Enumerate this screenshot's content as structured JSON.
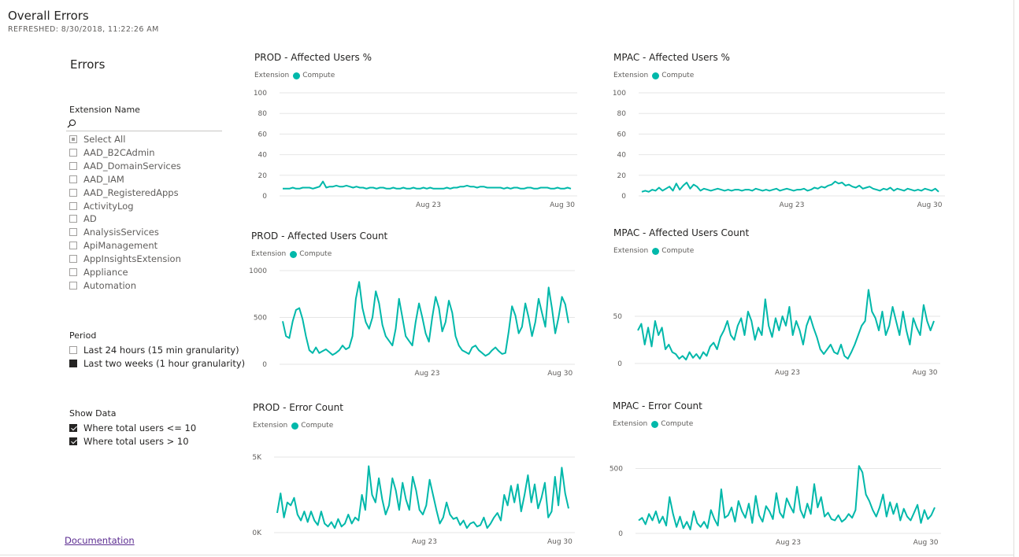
{
  "page": {
    "title": "Overall Errors",
    "refreshed": "REFRESHED: 8/30/2018, 11:22:26 AM"
  },
  "slicer": {
    "title": "Errors",
    "extension_label": "Extension Name",
    "search_icon": "search-icon",
    "extension_items": [
      {
        "label": "Select All",
        "state": "partial"
      },
      {
        "label": "AAD_B2CAdmin",
        "state": "unchecked"
      },
      {
        "label": "AAD_DomainServices",
        "state": "unchecked"
      },
      {
        "label": "AAD_IAM",
        "state": "unchecked"
      },
      {
        "label": "AAD_RegisteredApps",
        "state": "unchecked"
      },
      {
        "label": "ActivityLog",
        "state": "unchecked"
      },
      {
        "label": "AD",
        "state": "unchecked"
      },
      {
        "label": "AnalysisServices",
        "state": "unchecked"
      },
      {
        "label": "ApiManagement",
        "state": "unchecked"
      },
      {
        "label": "AppInsightsExtension",
        "state": "unchecked"
      },
      {
        "label": "Appliance",
        "state": "unchecked"
      },
      {
        "label": "Automation",
        "state": "unchecked"
      }
    ],
    "period_label": "Period",
    "period_items": [
      {
        "label": "Last 24 hours (15 min granularity)",
        "state": "unchecked"
      },
      {
        "label": "Last two weeks (1 hour granularity)",
        "state": "selected"
      }
    ],
    "show_data_label": "Show Data",
    "show_data_items": [
      {
        "label": "Where total users <= 10",
        "state": "checked"
      },
      {
        "label": "Where total users > 10",
        "state": "checked"
      }
    ]
  },
  "footer": {
    "documentation_link": "Documentation"
  },
  "colors": {
    "series": "#01b8aa",
    "text": "#252423",
    "muted": "#605e5c",
    "grid": "#e6e6e6",
    "link": "#5c2d91"
  },
  "chart_data": [
    {
      "id": "prod-affected-pct",
      "type": "line",
      "title": "PROD - Affected Users %",
      "legend_title": "Extension",
      "series": [
        {
          "name": "Compute",
          "values": [
            7,
            7,
            7,
            8,
            7,
            7,
            8,
            8,
            8,
            7,
            8,
            9,
            14,
            8,
            9,
            9,
            10,
            9,
            9,
            10,
            9,
            8,
            9,
            8,
            8,
            7,
            8,
            8,
            7,
            8,
            8,
            7,
            7,
            8,
            7,
            7,
            8,
            7,
            7,
            8,
            7,
            7,
            8,
            7,
            8,
            7,
            7,
            7,
            7,
            8,
            7,
            8,
            8,
            9,
            9,
            10,
            9,
            9,
            8,
            9,
            9,
            8,
            8,
            8,
            8,
            8,
            7,
            8,
            7,
            8,
            8,
            7,
            7,
            8,
            8,
            7,
            7,
            8,
            8,
            8,
            7,
            7,
            8,
            7,
            7,
            8,
            7
          ]
        }
      ],
      "x_ticks": [
        "Aug 23",
        "Aug 30"
      ],
      "y_ticks": [
        "0",
        "20",
        "40",
        "60",
        "80",
        "100"
      ],
      "ylim": [
        0,
        100
      ]
    },
    {
      "id": "mpac-affected-pct",
      "type": "line",
      "title": "MPAC - Affected Users %",
      "legend_title": "Extension",
      "series": [
        {
          "name": "Compute",
          "values": [
            4,
            5,
            4,
            6,
            5,
            8,
            5,
            7,
            9,
            5,
            12,
            6,
            10,
            13,
            7,
            11,
            9,
            5,
            7,
            6,
            5,
            6,
            7,
            6,
            5,
            6,
            5,
            6,
            6,
            5,
            6,
            6,
            5,
            7,
            6,
            5,
            6,
            5,
            6,
            7,
            5,
            6,
            7,
            6,
            5,
            6,
            6,
            7,
            5,
            6,
            8,
            7,
            9,
            8,
            10,
            11,
            14,
            12,
            13,
            10,
            11,
            9,
            8,
            10,
            7,
            8,
            9,
            7,
            6,
            5,
            7,
            6,
            8,
            5,
            7,
            6,
            5,
            7,
            6,
            5,
            6,
            5,
            7,
            6,
            5,
            7,
            4
          ]
        }
      ],
      "x_ticks": [
        "Aug 23",
        "Aug 30"
      ],
      "y_ticks": [
        "0",
        "20",
        "40",
        "60",
        "80",
        "100"
      ],
      "ylim": [
        0,
        100
      ]
    },
    {
      "id": "prod-affected-count",
      "type": "line",
      "title": "PROD - Affected Users Count",
      "legend_title": "Extension",
      "series": [
        {
          "name": "Compute",
          "values": [
            460,
            300,
            280,
            460,
            580,
            600,
            480,
            300,
            150,
            120,
            180,
            120,
            140,
            160,
            130,
            100,
            120,
            150,
            200,
            160,
            180,
            300,
            700,
            880,
            600,
            450,
            380,
            500,
            780,
            650,
            420,
            300,
            250,
            200,
            380,
            700,
            500,
            300,
            250,
            200,
            450,
            650,
            500,
            330,
            240,
            500,
            720,
            600,
            350,
            450,
            680,
            550,
            300,
            200,
            150,
            130,
            110,
            180,
            200,
            150,
            120,
            90,
            110,
            150,
            180,
            140,
            110,
            120,
            350,
            620,
            520,
            330,
            400,
            650,
            500,
            300,
            450,
            700,
            550,
            400,
            820,
            600,
            330,
            500,
            720,
            640,
            440
          ]
        }
      ],
      "x_ticks": [
        "Aug 23",
        "Aug 30"
      ],
      "y_ticks": [
        "0",
        "500",
        "1000"
      ],
      "ylim": [
        0,
        1000
      ]
    },
    {
      "id": "mpac-affected-count",
      "type": "line",
      "title": "MPAC - Affected Users Count",
      "legend_title": "Extension",
      "series": [
        {
          "name": "Compute",
          "values": [
            35,
            42,
            20,
            38,
            18,
            45,
            30,
            38,
            15,
            20,
            12,
            10,
            5,
            8,
            4,
            12,
            6,
            10,
            5,
            12,
            8,
            18,
            22,
            15,
            28,
            35,
            45,
            30,
            25,
            40,
            48,
            30,
            55,
            45,
            25,
            38,
            30,
            68,
            40,
            28,
            48,
            35,
            50,
            40,
            60,
            30,
            45,
            35,
            20,
            40,
            50,
            38,
            28,
            15,
            10,
            15,
            20,
            12,
            10,
            20,
            8,
            5,
            12,
            20,
            30,
            40,
            45,
            78,
            55,
            48,
            35,
            55,
            30,
            40,
            60,
            45,
            30,
            55,
            35,
            20,
            48,
            38,
            30,
            62,
            45,
            35,
            45
          ]
        }
      ],
      "x_ticks": [
        "Aug 23",
        "Aug 30"
      ],
      "y_ticks": [
        "0",
        "50"
      ],
      "ylim": [
        0,
        100
      ]
    },
    {
      "id": "prod-error-count",
      "type": "line",
      "title": "PROD - Error Count",
      "legend_title": "Extension",
      "series": [
        {
          "name": "Compute",
          "values": [
            1300,
            2600,
            1000,
            2000,
            1800,
            2300,
            1200,
            800,
            1400,
            700,
            1400,
            800,
            500,
            1400,
            600,
            400,
            700,
            300,
            900,
            400,
            600,
            1200,
            600,
            1000,
            800,
            2500,
            1500,
            4400,
            2500,
            2000,
            3600,
            2200,
            1200,
            1800,
            3600,
            2800,
            1500,
            3300,
            2200,
            1500,
            3700,
            2800,
            1500,
            1200,
            1800,
            3500,
            2500,
            1500,
            600,
            1000,
            2000,
            1200,
            900,
            1000,
            500,
            800,
            300,
            600,
            700,
            400,
            500,
            1000,
            300,
            600,
            1000,
            1300,
            800,
            2500,
            1800,
            3100,
            2000,
            3200,
            1400,
            2500,
            3800,
            2000,
            3200,
            1600,
            2300,
            3300,
            1000,
            1400,
            3700,
            1800,
            4300,
            2600,
            1600
          ]
        }
      ],
      "x_ticks": [
        "Aug 23",
        "Aug 30"
      ],
      "y_ticks": [
        "0K",
        "5K"
      ],
      "ylim": [
        0,
        5000
      ]
    },
    {
      "id": "mpac-error-count",
      "type": "line",
      "title": "MPAC - Error Count",
      "legend_title": "Extension",
      "series": [
        {
          "name": "Compute",
          "values": [
            100,
            120,
            70,
            150,
            100,
            170,
            80,
            130,
            60,
            280,
            150,
            50,
            130,
            40,
            90,
            30,
            170,
            80,
            50,
            90,
            40,
            180,
            110,
            60,
            340,
            120,
            140,
            200,
            90,
            250,
            170,
            120,
            230,
            80,
            290,
            140,
            90,
            210,
            170,
            110,
            310,
            160,
            120,
            270,
            210,
            160,
            360,
            180,
            120,
            230,
            150,
            380,
            200,
            280,
            130,
            160,
            110,
            100,
            140,
            90,
            110,
            150,
            120,
            180,
            520,
            470,
            300,
            250,
            180,
            130,
            200,
            300,
            130,
            240,
            150,
            230,
            100,
            190,
            130,
            100,
            160,
            220,
            80,
            180,
            110,
            140,
            200
          ]
        }
      ],
      "x_ticks": [
        "Aug 23",
        "Aug 30"
      ],
      "y_ticks": [
        "0",
        "500"
      ],
      "ylim": [
        0,
        600
      ]
    }
  ]
}
